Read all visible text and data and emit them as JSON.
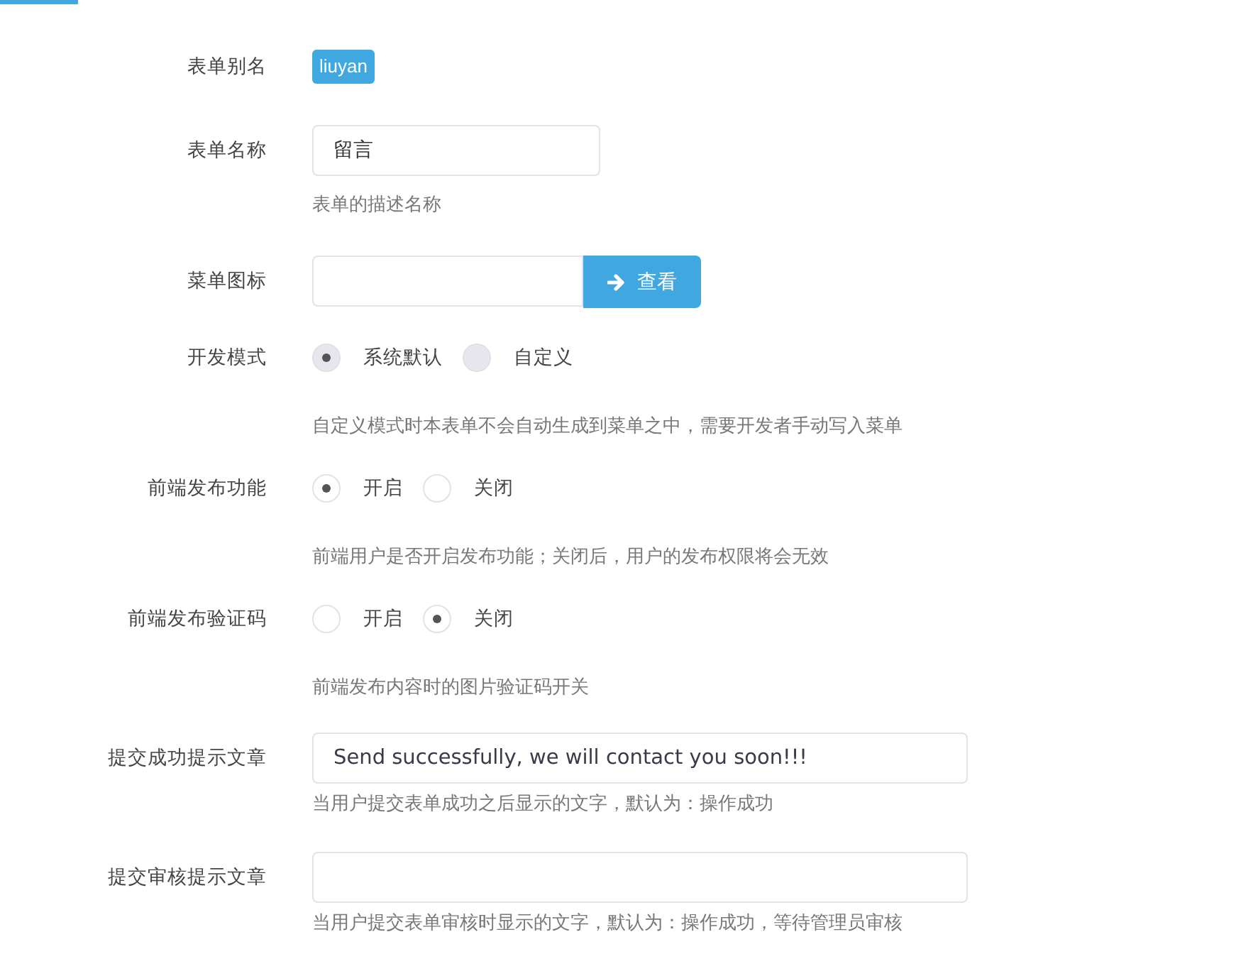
{
  "tab_indicator": {
    "selected": true
  },
  "rows": [
    {
      "kind": "tag",
      "label": "表单别名",
      "value": "liuyan"
    },
    {
      "kind": "input",
      "label": "表单名称",
      "value": "留言",
      "hint": "表单的描述名称"
    },
    {
      "kind": "icon_input",
      "label": "菜单图标",
      "button": "查看"
    },
    {
      "kind": "radio",
      "label": "开发模式",
      "disabled": true,
      "options": [
        {
          "label": "系统默认",
          "selected": true
        },
        {
          "label": "自定义",
          "selected": false
        }
      ],
      "hint": "自定义模式时本表单不会自动生成到菜单之中，需要开发者手动写入菜单"
    },
    {
      "kind": "radio",
      "label": "前端发布功能",
      "disabled": false,
      "options": [
        {
          "label": "开启",
          "selected": true
        },
        {
          "label": "关闭",
          "selected": false
        }
      ],
      "hint": "前端用户是否开启发布功能；关闭后，用户的发布权限将会无效"
    },
    {
      "kind": "radio",
      "label": "前端发布验证码",
      "disabled": false,
      "options": [
        {
          "label": "开启",
          "selected": false
        },
        {
          "label": "关闭",
          "selected": true
        }
      ],
      "hint": "前端发布内容时的图片验证码开关"
    },
    {
      "kind": "wide_input",
      "label": "提交成功提示文章",
      "value": "Send successfully, we will contact you soon!!!",
      "hint": "当用户提交表单成功之后显示的文字，默认为：操作成功"
    },
    {
      "kind": "wide_input",
      "label": "提交审核提示文章",
      "value": "",
      "hint": "当用户提交表单审核时显示的文字，默认为：操作成功，等待管理员审核"
    }
  ]
}
